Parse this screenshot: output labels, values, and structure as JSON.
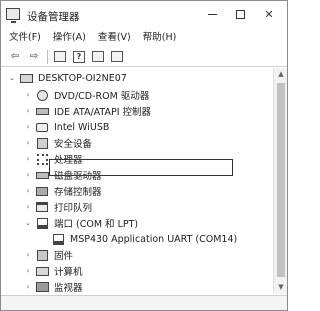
{
  "window": {
    "title": "设备管理器"
  },
  "menu": {
    "items": [
      "文件(F)",
      "操作(A)",
      "查看(V)",
      "帮助(H)"
    ]
  },
  "toolbar": {
    "icons": [
      "back-arrow-icon",
      "forward-arrow-icon",
      "properties-icon",
      "help-icon",
      "update-icon",
      "monitor-icon"
    ]
  },
  "tree": {
    "root": "DESKTOP-OI2NE07",
    "nodes": [
      {
        "label": "DVD/CD-ROM 驱动器",
        "icon": "disc-icon"
      },
      {
        "label": "IDE ATA/ATAPI 控制器",
        "icon": "drive-icon"
      },
      {
        "label": "Intel WiUSB",
        "icon": "usb-icon"
      },
      {
        "label": "安全设备",
        "icon": "key-icon"
      },
      {
        "label": "处理器",
        "icon": "chip-icon"
      },
      {
        "label": "磁盘驱动器",
        "icon": "drive-icon"
      },
      {
        "label": "存储控制器",
        "icon": "storage-icon"
      },
      {
        "label": "打印队列",
        "icon": "printer-icon"
      },
      {
        "label": "端口 (COM 和 LPT)",
        "icon": "port-icon",
        "expanded": true
      },
      {
        "label": "MSP430 Application UART (COM14)",
        "icon": "port-icon",
        "selected": true
      },
      {
        "label": "固件",
        "icon": "firmware-icon"
      },
      {
        "label": "计算机",
        "icon": "computer-icon"
      },
      {
        "label": "监视器",
        "icon": "monitor-icon"
      }
    ]
  }
}
